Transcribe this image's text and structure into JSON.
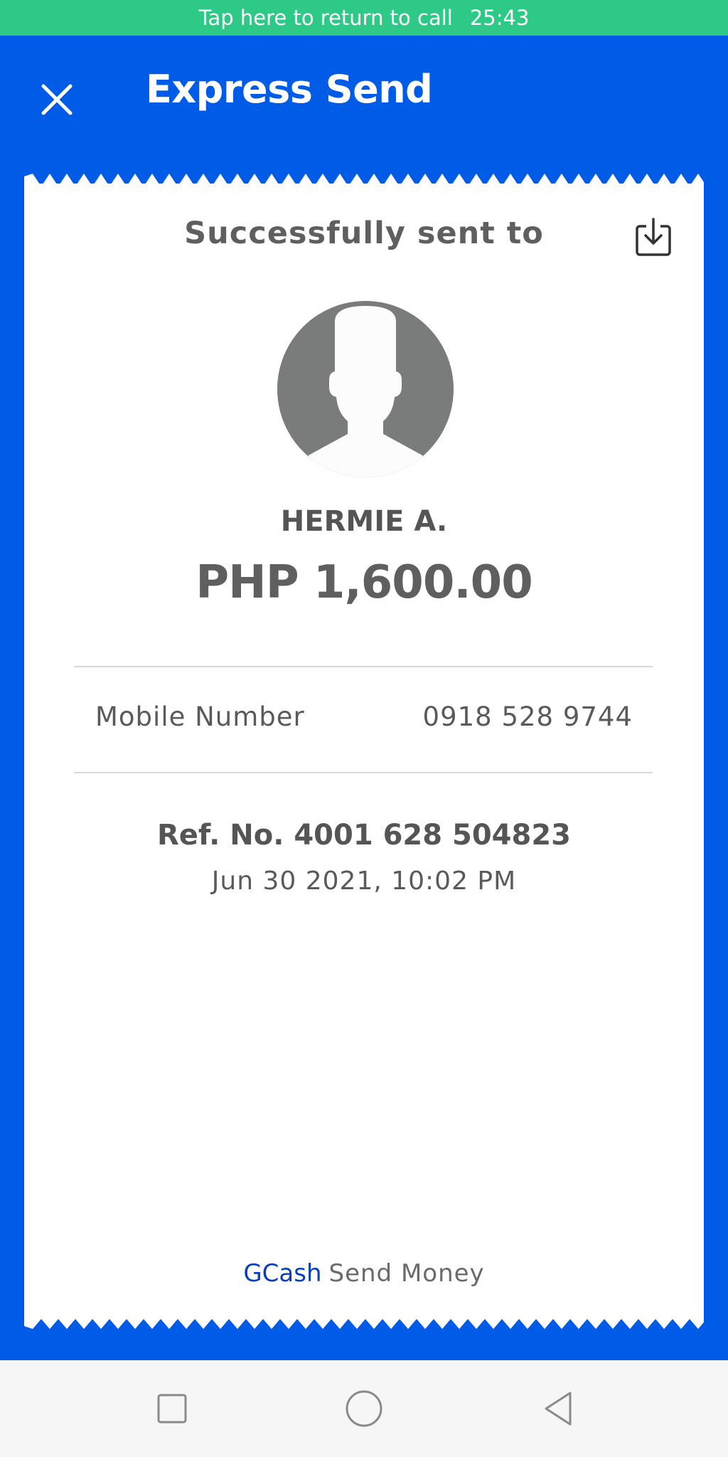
{
  "call_bar": {
    "message": "Tap here to return to call",
    "timer": "25:43"
  },
  "header": {
    "title": "Express Send",
    "close_icon": "close-icon"
  },
  "receipt": {
    "heading": "Successfully sent to",
    "download_icon": "download-icon",
    "avatar_icon": "person-avatar-icon",
    "recipient_name": "HERMIE A.",
    "amount": "PHP 1,600.00",
    "details": [
      {
        "label": "Mobile Number",
        "value": "0918 528 9744"
      }
    ],
    "reference": "Ref. No. 4001 628 504823",
    "timestamp": "Jun 30 2021, 10:02 PM",
    "footer": {
      "brand": "GCash",
      "service": "Send Money"
    }
  },
  "nav_bar": {
    "recents_icon": "square-icon",
    "home_icon": "circle-icon",
    "back_icon": "triangle-back-icon"
  },
  "colors": {
    "primary": "#005ce6",
    "call_bar": "#2ec887",
    "brand_text": "#0b3dbc",
    "avatar_gray": "#7a7b7b"
  }
}
